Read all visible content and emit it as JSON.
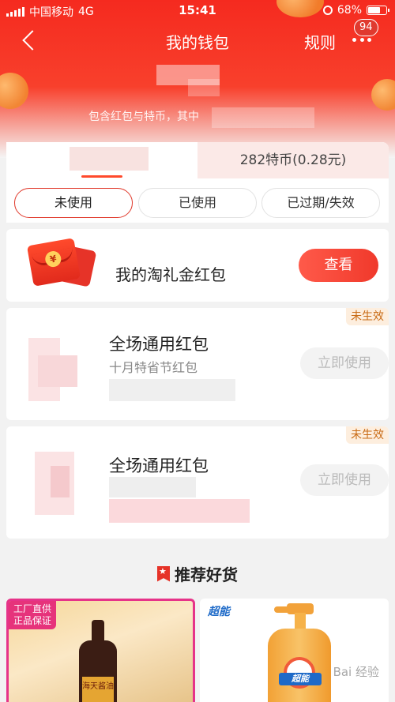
{
  "status_bar": {
    "carrier": "中国移动",
    "network": "4G",
    "time": "15:41",
    "battery": "68%",
    "battery_level": 0.68
  },
  "nav": {
    "title": "我的钱包",
    "rules": "规则",
    "badge": "94"
  },
  "summary": {
    "text": "包含红包与特币，其中"
  },
  "tabs": {
    "right": "282特币(0.28元)"
  },
  "filters": [
    "未使用",
    "已使用",
    "已过期/失效"
  ],
  "gift_card": {
    "title": "我的淘礼金红包",
    "button": "查看"
  },
  "coupons": [
    {
      "title": "全场通用红包",
      "subtitle": "十月特省节红包",
      "tag": "未生效",
      "button": "立即使用"
    },
    {
      "title": "全场通用红包",
      "subtitle": "",
      "tag": "未生效",
      "button": "立即使用"
    }
  ],
  "recommend": {
    "title": "推荐好货"
  },
  "products": {
    "left_tag_line1": "工厂直供",
    "left_tag_line2": "正品保证",
    "left_label": "海天酱油",
    "right_brand": "超能"
  },
  "watermark": "Bai 经验"
}
